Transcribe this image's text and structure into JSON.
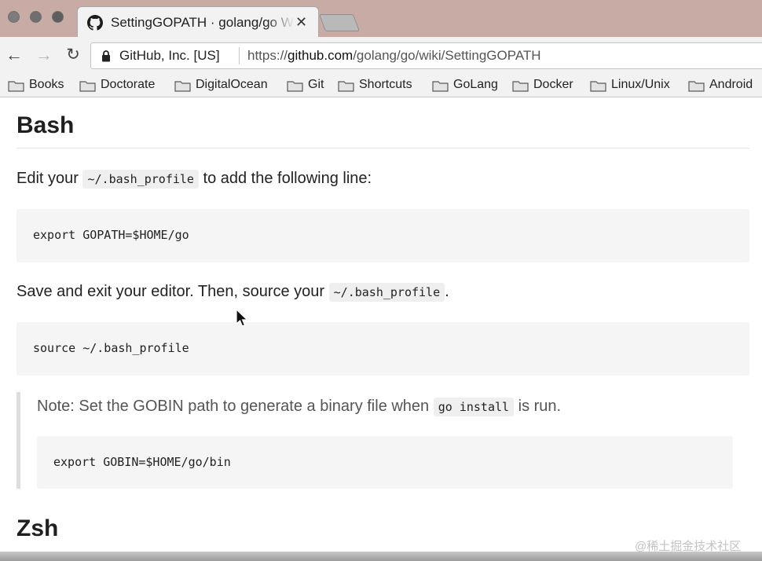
{
  "browser": {
    "tab": {
      "title": "SettingGOPATH · golang/go Wi",
      "close_glyph": "✕",
      "icon": "github-icon"
    },
    "nav": {
      "back_glyph": "←",
      "forward_glyph": "→",
      "reload_glyph": "↻"
    },
    "omnibox": {
      "site_identity": "GitHub, Inc. [US]",
      "url_scheme": "https://",
      "url_host": "github.com",
      "url_path": "/golang/go/wiki/SettingGOPATH"
    },
    "bookmarks": [
      "Books",
      "Doctorate",
      "DigitalOcean",
      "Git",
      "Shortcuts",
      "GoLang",
      "Docker",
      "Linux/Unix",
      "Android"
    ]
  },
  "page": {
    "heading_bash": "Bash",
    "p1_before": "Edit your ",
    "p1_code": "~/.bash_profile",
    "p1_after": " to add the following line:",
    "code1": "export GOPATH=$HOME/go",
    "p2_before": "Save and exit your editor. Then, source your ",
    "p2_code": "~/.bash_profile",
    "p2_after": ".",
    "code2": "source ~/.bash_profile",
    "note_before": "Note: Set the GOBIN path to generate a binary file when ",
    "note_code": "go install",
    "note_after": " is run.",
    "code3": "export GOBIN=$HOME/go/bin",
    "heading_zsh": "Zsh"
  },
  "watermark": "@稀土掘金技术社区",
  "colors": {
    "tab_strip": "#c9aba6",
    "toolbar": "#f2f2f2",
    "code_background": "#f5f5f5",
    "blockquote_border": "#dddddd"
  }
}
